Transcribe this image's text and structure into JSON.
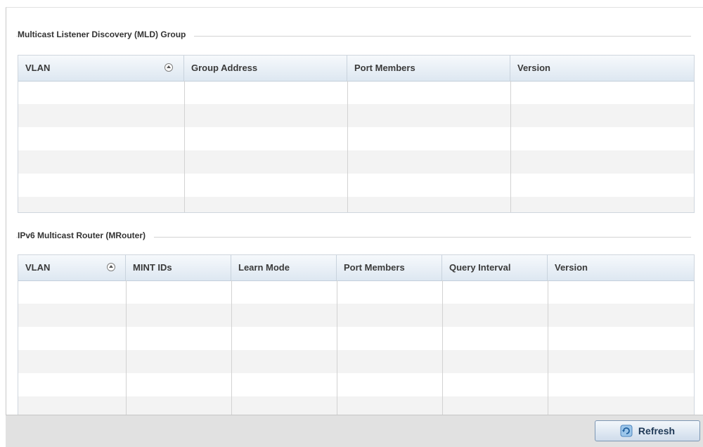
{
  "mld_group": {
    "title": "Multicast Listener Discovery (MLD) Group",
    "columns": [
      {
        "label": "VLAN",
        "sortable": true
      },
      {
        "label": "Group Address",
        "sortable": false
      },
      {
        "label": "Port Members",
        "sortable": false
      },
      {
        "label": "Version",
        "sortable": false
      }
    ],
    "rows": []
  },
  "mrouter": {
    "title": "IPv6 Multicast Router (MRouter)",
    "columns": [
      {
        "label": "VLAN",
        "sortable": true
      },
      {
        "label": "MINT IDs",
        "sortable": false
      },
      {
        "label": "Learn Mode",
        "sortable": false
      },
      {
        "label": "Port Members",
        "sortable": false
      },
      {
        "label": "Query Interval",
        "sortable": false
      },
      {
        "label": "Version",
        "sortable": false
      }
    ],
    "rows": []
  },
  "footer": {
    "refresh_label": "Refresh",
    "refresh_icon": "refresh-icon"
  },
  "colors": {
    "header_gradient_top": "#f6f9fc",
    "header_gradient_bottom": "#dde7f1",
    "row_alt": "#f3f3f3",
    "footer_bg": "#e1e1e1",
    "button_text": "#1e3856"
  }
}
